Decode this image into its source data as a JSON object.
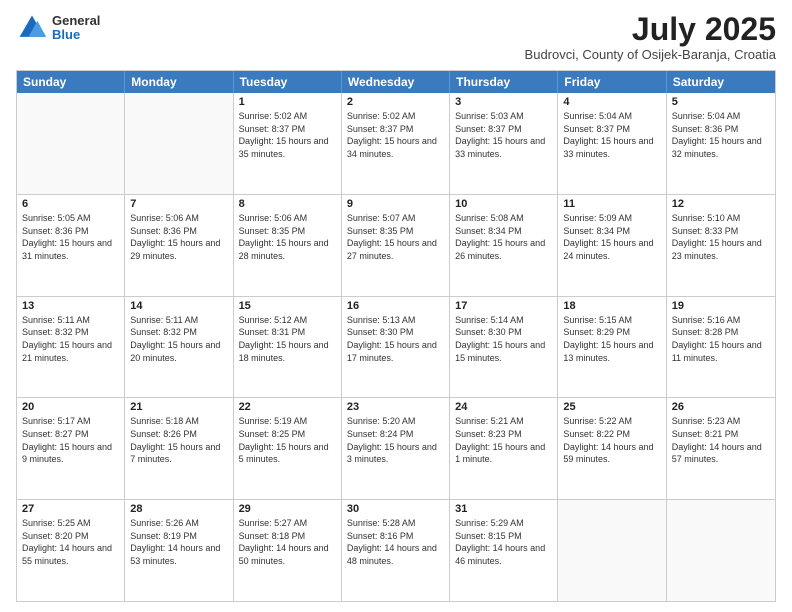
{
  "header": {
    "logo": {
      "general": "General",
      "blue": "Blue"
    },
    "title": "July 2025",
    "location": "Budrovci, County of Osijek-Baranja, Croatia"
  },
  "weekdays": [
    "Sunday",
    "Monday",
    "Tuesday",
    "Wednesday",
    "Thursday",
    "Friday",
    "Saturday"
  ],
  "rows": [
    [
      {
        "day": "",
        "empty": true
      },
      {
        "day": "",
        "empty": true
      },
      {
        "day": "1",
        "sunrise": "Sunrise: 5:02 AM",
        "sunset": "Sunset: 8:37 PM",
        "daylight": "Daylight: 15 hours and 35 minutes."
      },
      {
        "day": "2",
        "sunrise": "Sunrise: 5:02 AM",
        "sunset": "Sunset: 8:37 PM",
        "daylight": "Daylight: 15 hours and 34 minutes."
      },
      {
        "day": "3",
        "sunrise": "Sunrise: 5:03 AM",
        "sunset": "Sunset: 8:37 PM",
        "daylight": "Daylight: 15 hours and 33 minutes."
      },
      {
        "day": "4",
        "sunrise": "Sunrise: 5:04 AM",
        "sunset": "Sunset: 8:37 PM",
        "daylight": "Daylight: 15 hours and 33 minutes."
      },
      {
        "day": "5",
        "sunrise": "Sunrise: 5:04 AM",
        "sunset": "Sunset: 8:36 PM",
        "daylight": "Daylight: 15 hours and 32 minutes."
      }
    ],
    [
      {
        "day": "6",
        "sunrise": "Sunrise: 5:05 AM",
        "sunset": "Sunset: 8:36 PM",
        "daylight": "Daylight: 15 hours and 31 minutes."
      },
      {
        "day": "7",
        "sunrise": "Sunrise: 5:06 AM",
        "sunset": "Sunset: 8:36 PM",
        "daylight": "Daylight: 15 hours and 29 minutes."
      },
      {
        "day": "8",
        "sunrise": "Sunrise: 5:06 AM",
        "sunset": "Sunset: 8:35 PM",
        "daylight": "Daylight: 15 hours and 28 minutes."
      },
      {
        "day": "9",
        "sunrise": "Sunrise: 5:07 AM",
        "sunset": "Sunset: 8:35 PM",
        "daylight": "Daylight: 15 hours and 27 minutes."
      },
      {
        "day": "10",
        "sunrise": "Sunrise: 5:08 AM",
        "sunset": "Sunset: 8:34 PM",
        "daylight": "Daylight: 15 hours and 26 minutes."
      },
      {
        "day": "11",
        "sunrise": "Sunrise: 5:09 AM",
        "sunset": "Sunset: 8:34 PM",
        "daylight": "Daylight: 15 hours and 24 minutes."
      },
      {
        "day": "12",
        "sunrise": "Sunrise: 5:10 AM",
        "sunset": "Sunset: 8:33 PM",
        "daylight": "Daylight: 15 hours and 23 minutes."
      }
    ],
    [
      {
        "day": "13",
        "sunrise": "Sunrise: 5:11 AM",
        "sunset": "Sunset: 8:32 PM",
        "daylight": "Daylight: 15 hours and 21 minutes."
      },
      {
        "day": "14",
        "sunrise": "Sunrise: 5:11 AM",
        "sunset": "Sunset: 8:32 PM",
        "daylight": "Daylight: 15 hours and 20 minutes."
      },
      {
        "day": "15",
        "sunrise": "Sunrise: 5:12 AM",
        "sunset": "Sunset: 8:31 PM",
        "daylight": "Daylight: 15 hours and 18 minutes."
      },
      {
        "day": "16",
        "sunrise": "Sunrise: 5:13 AM",
        "sunset": "Sunset: 8:30 PM",
        "daylight": "Daylight: 15 hours and 17 minutes."
      },
      {
        "day": "17",
        "sunrise": "Sunrise: 5:14 AM",
        "sunset": "Sunset: 8:30 PM",
        "daylight": "Daylight: 15 hours and 15 minutes."
      },
      {
        "day": "18",
        "sunrise": "Sunrise: 5:15 AM",
        "sunset": "Sunset: 8:29 PM",
        "daylight": "Daylight: 15 hours and 13 minutes."
      },
      {
        "day": "19",
        "sunrise": "Sunrise: 5:16 AM",
        "sunset": "Sunset: 8:28 PM",
        "daylight": "Daylight: 15 hours and 11 minutes."
      }
    ],
    [
      {
        "day": "20",
        "sunrise": "Sunrise: 5:17 AM",
        "sunset": "Sunset: 8:27 PM",
        "daylight": "Daylight: 15 hours and 9 minutes."
      },
      {
        "day": "21",
        "sunrise": "Sunrise: 5:18 AM",
        "sunset": "Sunset: 8:26 PM",
        "daylight": "Daylight: 15 hours and 7 minutes."
      },
      {
        "day": "22",
        "sunrise": "Sunrise: 5:19 AM",
        "sunset": "Sunset: 8:25 PM",
        "daylight": "Daylight: 15 hours and 5 minutes."
      },
      {
        "day": "23",
        "sunrise": "Sunrise: 5:20 AM",
        "sunset": "Sunset: 8:24 PM",
        "daylight": "Daylight: 15 hours and 3 minutes."
      },
      {
        "day": "24",
        "sunrise": "Sunrise: 5:21 AM",
        "sunset": "Sunset: 8:23 PM",
        "daylight": "Daylight: 15 hours and 1 minute."
      },
      {
        "day": "25",
        "sunrise": "Sunrise: 5:22 AM",
        "sunset": "Sunset: 8:22 PM",
        "daylight": "Daylight: 14 hours and 59 minutes."
      },
      {
        "day": "26",
        "sunrise": "Sunrise: 5:23 AM",
        "sunset": "Sunset: 8:21 PM",
        "daylight": "Daylight: 14 hours and 57 minutes."
      }
    ],
    [
      {
        "day": "27",
        "sunrise": "Sunrise: 5:25 AM",
        "sunset": "Sunset: 8:20 PM",
        "daylight": "Daylight: 14 hours and 55 minutes."
      },
      {
        "day": "28",
        "sunrise": "Sunrise: 5:26 AM",
        "sunset": "Sunset: 8:19 PM",
        "daylight": "Daylight: 14 hours and 53 minutes."
      },
      {
        "day": "29",
        "sunrise": "Sunrise: 5:27 AM",
        "sunset": "Sunset: 8:18 PM",
        "daylight": "Daylight: 14 hours and 50 minutes."
      },
      {
        "day": "30",
        "sunrise": "Sunrise: 5:28 AM",
        "sunset": "Sunset: 8:16 PM",
        "daylight": "Daylight: 14 hours and 48 minutes."
      },
      {
        "day": "31",
        "sunrise": "Sunrise: 5:29 AM",
        "sunset": "Sunset: 8:15 PM",
        "daylight": "Daylight: 14 hours and 46 minutes."
      },
      {
        "day": "",
        "empty": true
      },
      {
        "day": "",
        "empty": true
      }
    ]
  ]
}
